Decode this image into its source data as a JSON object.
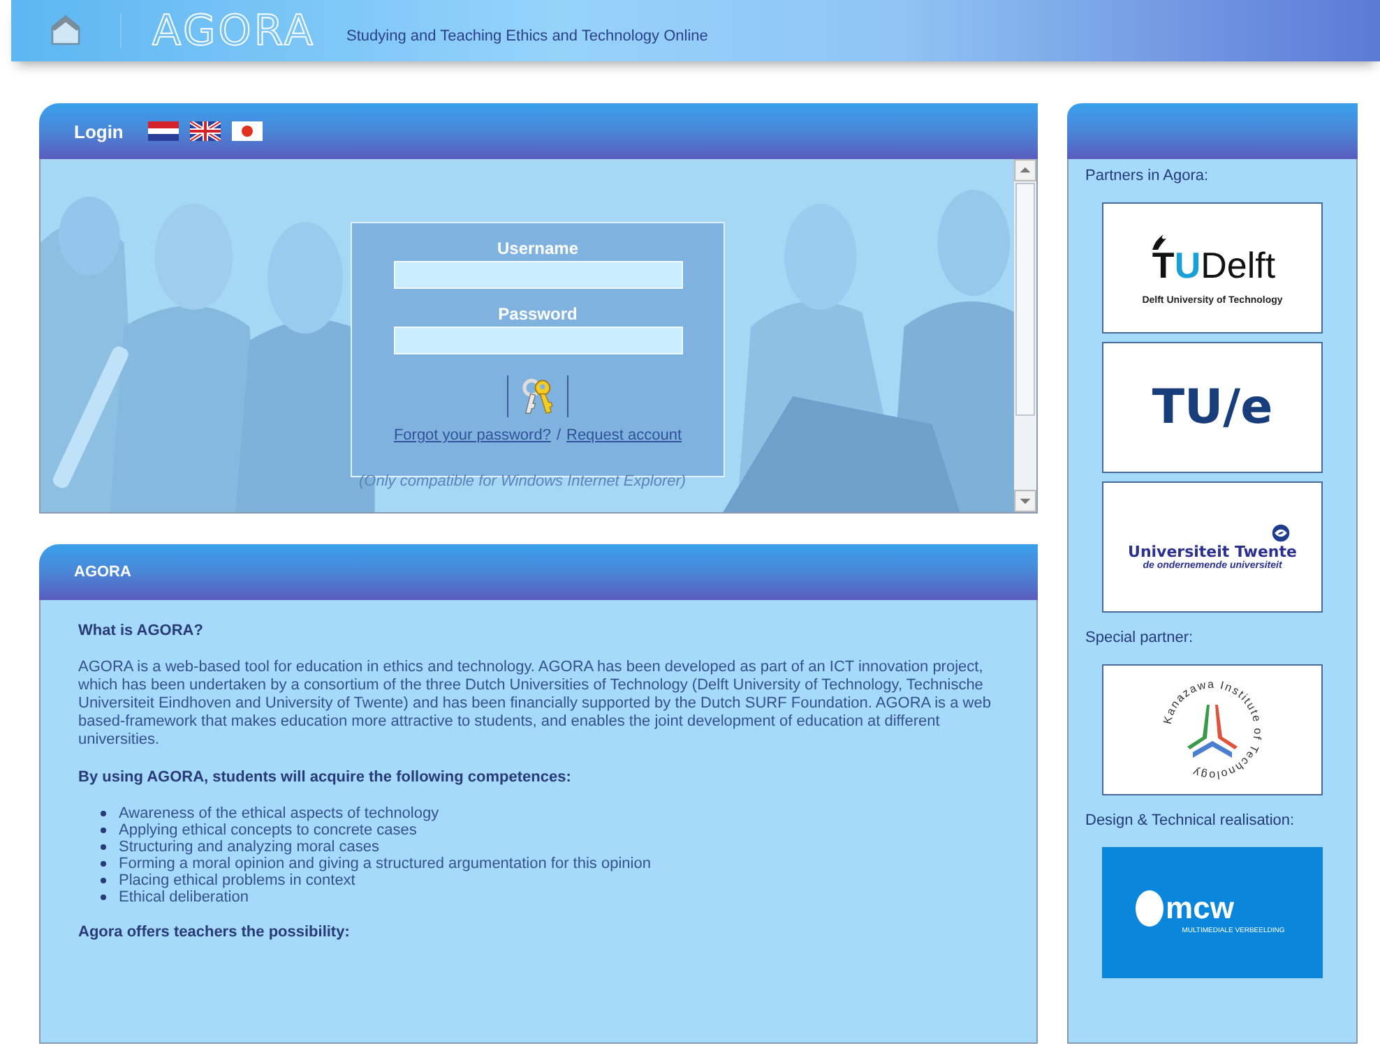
{
  "header": {
    "logo": "AGORA",
    "tagline": "Studying and Teaching Ethics and Technology Online"
  },
  "login_panel": {
    "title": "Login",
    "languages": [
      {
        "kind": "netherlands"
      },
      {
        "kind": "united-kingdom"
      },
      {
        "kind": "japan"
      }
    ],
    "username_label": "Username",
    "password_label": "Password",
    "forgot_link": "Forgot your password?",
    "separator": "/",
    "request_link": "Request account",
    "note": "(Only compatible for Windows Internet Explorer)"
  },
  "agora_panel": {
    "title": "AGORA",
    "sections": [
      {
        "kind": "heading",
        "text": "What is AGORA?"
      },
      {
        "kind": "paragraph",
        "text": "AGORA is a web-based tool for education in ethics and technology. AGORA has been developed as part of an ICT innovation project, which has been undertaken by a consortium of the three Dutch Universities of Technology (Delft University of Technology, Technische Universiteit Eindhoven and University of Twente) and has been financially supported by the Dutch SURF Foundation. AGORA is a web based-framework that makes education more attractive to students, and enables the joint development of education at different universities."
      },
      {
        "kind": "heading",
        "text": "By using AGORA, students will acquire the following competences:"
      },
      {
        "kind": "list",
        "items": [
          "Awareness of the ethical aspects of technology",
          "Applying ethical concepts to concrete cases",
          "Structuring and analyzing moral cases",
          "Forming a moral opinion and giving a structured argumentation for this opinion",
          "Placing ethical problems in context",
          "Ethical deliberation"
        ]
      },
      {
        "kind": "heading",
        "text": "Agora offers teachers the possibility:"
      }
    ]
  },
  "sidebar": {
    "groups": [
      {
        "heading": "Partners in Agora:",
        "logos": [
          {
            "kind": "tudelft",
            "mark": "TU",
            "name": "Delft",
            "subtitle": "Delft University of Technology"
          },
          {
            "kind": "tue",
            "name": "TU/e"
          },
          {
            "kind": "twente",
            "name": "Universiteit Twente",
            "subtitle": "de ondernemende universiteit"
          }
        ]
      },
      {
        "heading": "Special partner:",
        "logos": [
          {
            "kind": "kanazawa",
            "name": "Kanazawa Institute of Technology"
          }
        ]
      },
      {
        "heading": "Design & Technical realisation:",
        "logos": [
          {
            "kind": "mcw",
            "name": "mcw",
            "subtitle": "MULTIMEDIALE VERBEELDING"
          }
        ]
      }
    ]
  }
}
